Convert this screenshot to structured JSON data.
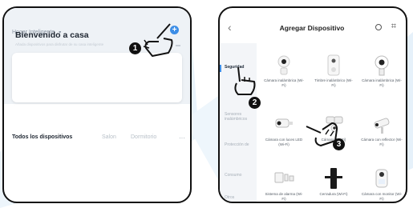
{
  "colors": {
    "accent": "#3d8ee6",
    "frame": "#111111",
    "marker": "#111111"
  },
  "left_screen": {
    "home_selector": "Hogar Inteligente",
    "add_icon": "+",
    "welcome_title": "Bienvenido a casa",
    "welcome_subtitle": "Añada dispositivos para disfrutar de su casa inteligente",
    "tabs": {
      "all_devices": "Todos los dispositivos",
      "tab2": "Salon",
      "tab3": "Dormitorio",
      "more": "···"
    }
  },
  "right_screen": {
    "title": "Agregar Dispositivo",
    "categories": [
      "Seguridad",
      "Sensores inalámbricos",
      "Protección de",
      "Consumo",
      "Otros"
    ],
    "devices": [
      {
        "label": "Cámara inalámbrica (Wi-Fi)",
        "icon": "indoor-camera-icon"
      },
      {
        "label": "Timbre inalámbrico (Wi-Fi)",
        "icon": "doorbell-icon"
      },
      {
        "label": "Cámara inalámbrica (Wi-Fi)",
        "icon": "round-camera-icon"
      },
      {
        "label": "Cámara con luces LED (Wi-Fi)",
        "icon": "led-camera-icon"
      },
      {
        "label": "Cámara (Wi-Fi)",
        "icon": "floodlight-camera-icon"
      },
      {
        "label": "Cámara con reflector (Wi-Fi)",
        "icon": "bullet-camera-icon"
      },
      {
        "label": "Sistema de alarma (Wi-Fi)",
        "icon": "alarm-system-icon"
      },
      {
        "label": "Cerradura (Wi-Fi)",
        "icon": "smart-lock-icon"
      },
      {
        "label": "Cámara con monitor (Wi-Fi)",
        "icon": "monitor-camera-icon"
      }
    ]
  },
  "steps": [
    "1",
    "2",
    "3"
  ]
}
